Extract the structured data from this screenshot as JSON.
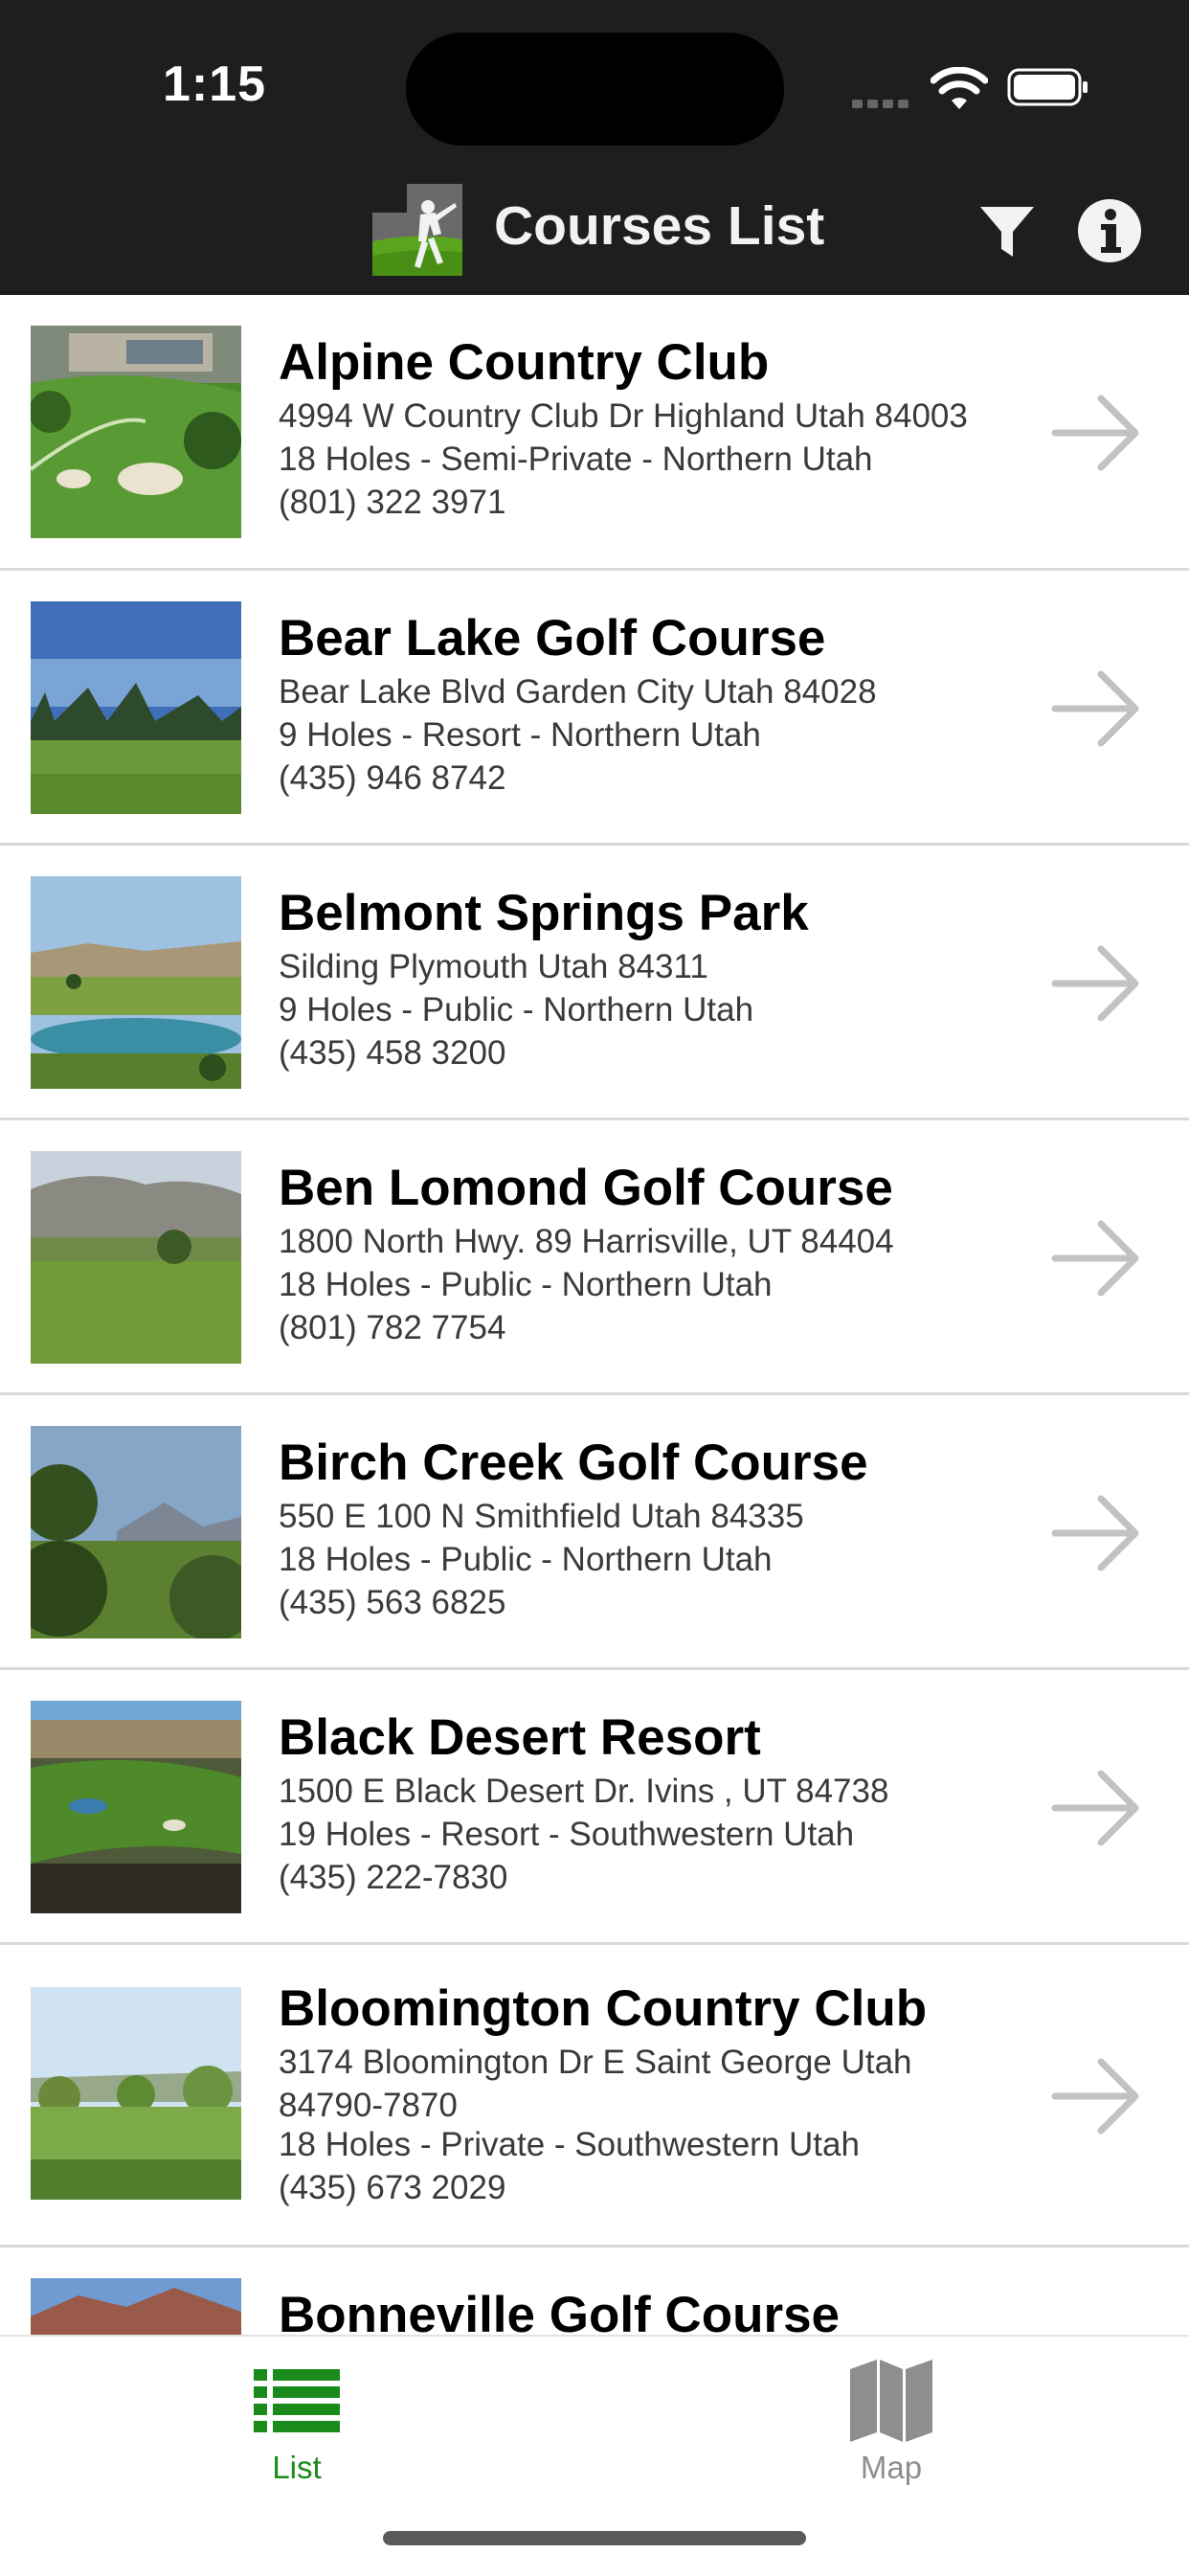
{
  "status_bar": {
    "time": "1:15"
  },
  "nav": {
    "title": "Courses List"
  },
  "courses": [
    {
      "name": "Alpine Country Club",
      "address": "4994 W Country Club Dr Highland Utah 84003",
      "info": "18 Holes - Semi-Private - Northern Utah",
      "phone": "(801) 322 3971"
    },
    {
      "name": "Bear Lake Golf Course",
      "address": "Bear Lake Blvd Garden City Utah 84028",
      "info": "9 Holes - Resort - Northern Utah",
      "phone": "(435) 946 8742"
    },
    {
      "name": "Belmont Springs Park",
      "address": "Silding Plymouth Utah 84311",
      "info": "9 Holes - Public - Northern Utah",
      "phone": "(435) 458 3200"
    },
    {
      "name": "Ben Lomond Golf Course",
      "address": "1800 North Hwy. 89 Harrisville, UT 84404",
      "info": "18 Holes - Public - Northern Utah",
      "phone": "(801) 782 7754"
    },
    {
      "name": "Birch Creek Golf Course",
      "address": "550 E 100 N Smithfield Utah 84335",
      "info": "18 Holes - Public - Northern Utah",
      "phone": "(435) 563 6825"
    },
    {
      "name": "Black Desert Resort",
      "address": "1500 E Black Desert Dr. Ivins , UT 84738",
      "info": "19 Holes - Resort - Southwestern Utah",
      "phone": "(435) 222-7830"
    },
    {
      "name": "Bloomington Country Club",
      "address": "3174 Bloomington Dr E Saint George Utah 84790-7870",
      "info": "18 Holes - Private - Southwestern Utah",
      "phone": "(435) 673 2029"
    },
    {
      "name": "Bonneville Golf Course",
      "address": "",
      "info": "",
      "phone": ""
    }
  ],
  "tabs": [
    {
      "label": "List",
      "icon": "list-icon",
      "active": true,
      "color": "#1a8a1a"
    },
    {
      "label": "Map",
      "icon": "map-icon",
      "active": false,
      "color": "#8e8e8e"
    }
  ],
  "colors": {
    "bar_bg": "#1e1e1e",
    "accent": "#1a8a1a",
    "arrow": "#c2c2c2"
  }
}
